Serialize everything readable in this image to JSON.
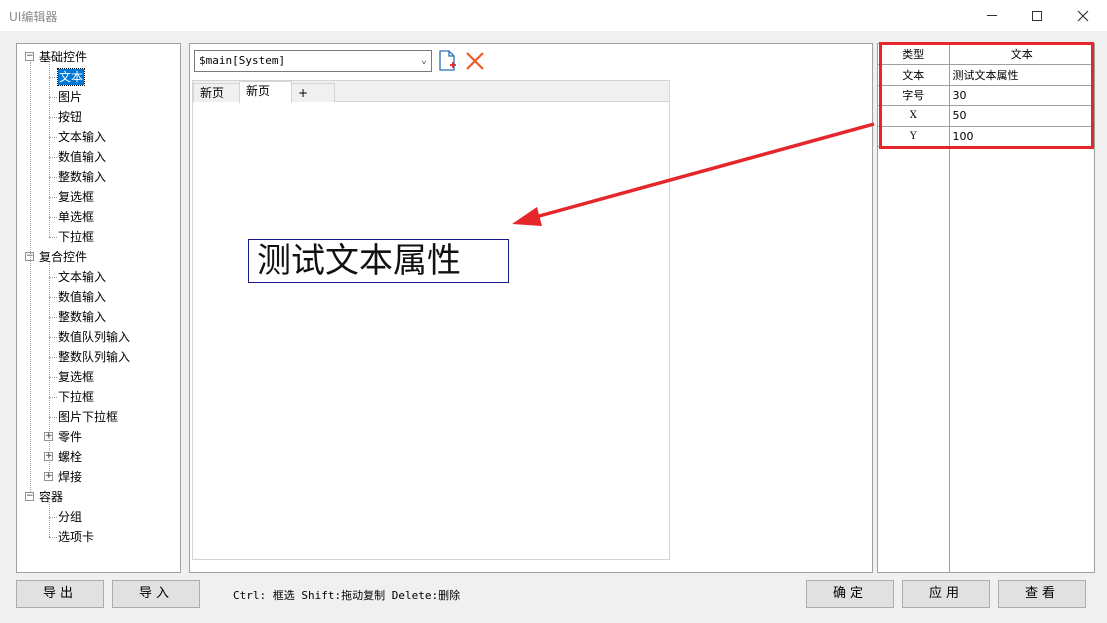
{
  "window": {
    "title": "UI编辑器"
  },
  "tree": {
    "items": [
      {
        "label": "基础控件",
        "level": 0,
        "expander": "minus"
      },
      {
        "label": "文本",
        "level": 1,
        "selected": true
      },
      {
        "label": "图片",
        "level": 1
      },
      {
        "label": "按钮",
        "level": 1
      },
      {
        "label": "文本输入",
        "level": 1
      },
      {
        "label": "数值输入",
        "level": 1
      },
      {
        "label": "整数输入",
        "level": 1
      },
      {
        "label": "复选框",
        "level": 1
      },
      {
        "label": "单选框",
        "level": 1
      },
      {
        "label": "下拉框",
        "level": 1
      },
      {
        "label": "复合控件",
        "level": 0,
        "expander": "minus"
      },
      {
        "label": "文本输入",
        "level": 1
      },
      {
        "label": "数值输入",
        "level": 1
      },
      {
        "label": "整数输入",
        "level": 1
      },
      {
        "label": "数值队列输入",
        "level": 1
      },
      {
        "label": "整数队列输入",
        "level": 1
      },
      {
        "label": "复选框",
        "level": 1
      },
      {
        "label": "下拉框",
        "level": 1
      },
      {
        "label": "图片下拉框",
        "level": 1
      },
      {
        "label": "零件",
        "level": 1,
        "expander": "plus"
      },
      {
        "label": "螺栓",
        "level": 1,
        "expander": "plus"
      },
      {
        "label": "焊接",
        "level": 1,
        "expander": "plus"
      },
      {
        "label": "容器",
        "level": 0,
        "expander": "minus"
      },
      {
        "label": "分组",
        "level": 1
      },
      {
        "label": "选项卡",
        "level": 1
      }
    ]
  },
  "editor": {
    "combo_value": "$main[System]",
    "tabs": [
      {
        "label": "新页"
      },
      {
        "label": "新页",
        "active": true
      },
      {
        "label": "+"
      }
    ],
    "preview_text": "测试文本属性"
  },
  "properties": {
    "header": {
      "key": "类型",
      "value": "文本"
    },
    "rows": [
      {
        "key": "文本",
        "value": "测试文本属性"
      },
      {
        "key": "字号",
        "value": "30"
      },
      {
        "key": "X",
        "value": "50"
      },
      {
        "key": "Y",
        "value": "100"
      }
    ]
  },
  "footer": {
    "export_label": "导出",
    "import_label": "导入",
    "hint": "Ctrl: 框选 Shift:拖动复制 Delete:删除",
    "confirm_label": "确定",
    "apply_label": "应用",
    "view_label": "查看"
  },
  "colors": {
    "selection": "#0078d7",
    "annotation": "#e5262b",
    "preview_border": "#1a1a8c"
  }
}
